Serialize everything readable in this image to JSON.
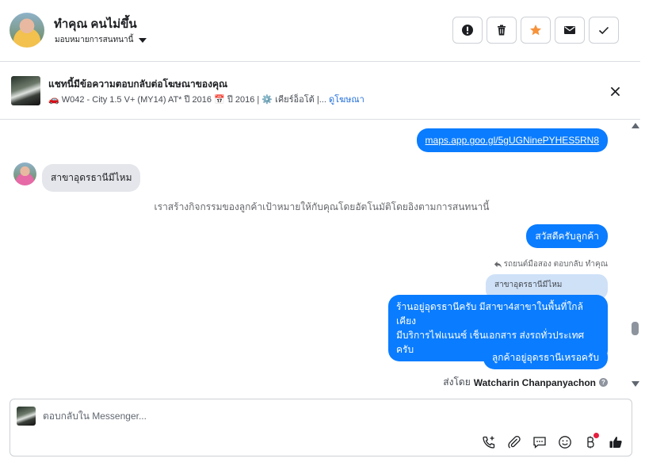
{
  "header": {
    "contact_name": "ทำคุณ คนไม่ขึ้น",
    "assign_label": "มอบหมายการสนทนานี้",
    "actions": [
      "alert-icon",
      "trash-icon",
      "star-icon",
      "mail-icon",
      "check-icon"
    ],
    "star_color": "#f7923a"
  },
  "ad_context": {
    "title": "แชทนี้มีข้อความตอบกลับต่อโฆษณาของคุณ",
    "description": "🚗 W042 - City 1.5 V+ (MY14) AT* ปี 2016 📅 ปี 2016 | ⚙️ เคียร์อ็อโต้ |...",
    "link_label": "ดูโฆษณา"
  },
  "messages": {
    "link_message": "maps.app.goo.gl/5gUGNinePYHES5RN8",
    "incoming_message": "สาขาอุดรธานีมีไหม",
    "system_note": "เราสร้างกิจกรรมของลูกค้าเป้าหมายให้กับคุณโดยอัตโนมัติโดยอิงตามการสนทนานี้",
    "greeting": "สวัสดีครับลูกค้า",
    "reply_meta": "รถยนต์มือสอง ตอบกลับ ทำคุณ",
    "quoted_text": "สาขาอุดรธานีมีไหม",
    "reply_line1": "ร้านอยู่อุดรธานีครับ มีสาขา4สาขาในพื้นที่ใกล้เคียง",
    "reply_line2": "มีบริการไฟแนนซ์ เช็นเอกสาร ส่งรถทั่วประเทศครับ",
    "question": "ลูกค้าอยู่อุดรธานีเหรอครับ",
    "sent_by_prefix": "ส่งโดย",
    "sent_by_name": "Watcharin Chanpanyachon"
  },
  "composer": {
    "placeholder": "ตอบกลับใน Messenger...",
    "tools": [
      "add-call-icon",
      "attachment-icon",
      "saved-reply-icon",
      "emoji-icon",
      "payment-icon",
      "like-icon"
    ]
  },
  "colors": {
    "accent": "#0a7cff",
    "incoming_bubble": "#e4e6eb",
    "quoted_bubble": "#cfe1f7",
    "like_color": "#1c1e21"
  }
}
